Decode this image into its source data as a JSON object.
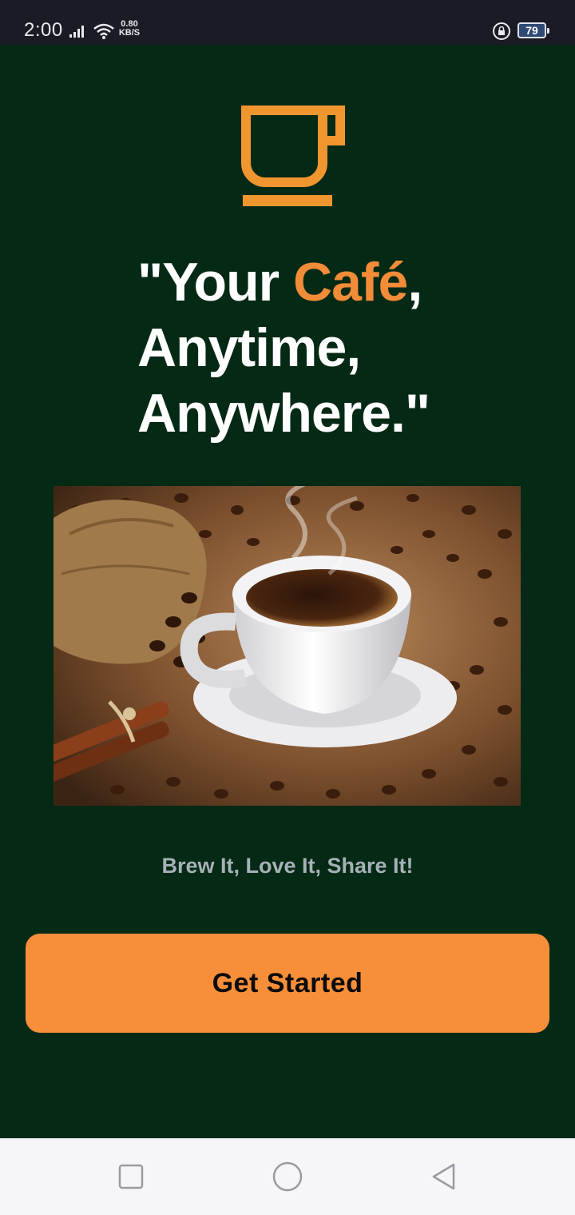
{
  "status_bar": {
    "time": "2:00",
    "net_speed_value": "0.80",
    "net_speed_unit": "KB/S",
    "battery_level": "79",
    "icons": [
      "signal-icon",
      "wifi-icon",
      "rotation-lock-icon",
      "battery-icon"
    ]
  },
  "logo": {
    "icon": "coffee-cup-icon"
  },
  "headline": {
    "line1_prefix": "\"Your ",
    "line1_accent": "Café",
    "line1_suffix": ",",
    "line2": "Anytime,",
    "line3": "Anywhere.\""
  },
  "hero_image": {
    "subject": "coffee cup on saucer with coffee beans, burlap sack and cinnamon sticks"
  },
  "tagline": "Brew It, Love It, Share It!",
  "cta": {
    "label": "Get Started"
  },
  "nav_bar": {
    "icons": [
      "recent-apps-icon",
      "home-icon",
      "back-icon"
    ]
  },
  "colors": {
    "background": "#042915",
    "accent": "#f28c38",
    "button": "#f78f3a",
    "status_bar": "#1b1b26",
    "nav_bar": "#f6f6f8"
  }
}
